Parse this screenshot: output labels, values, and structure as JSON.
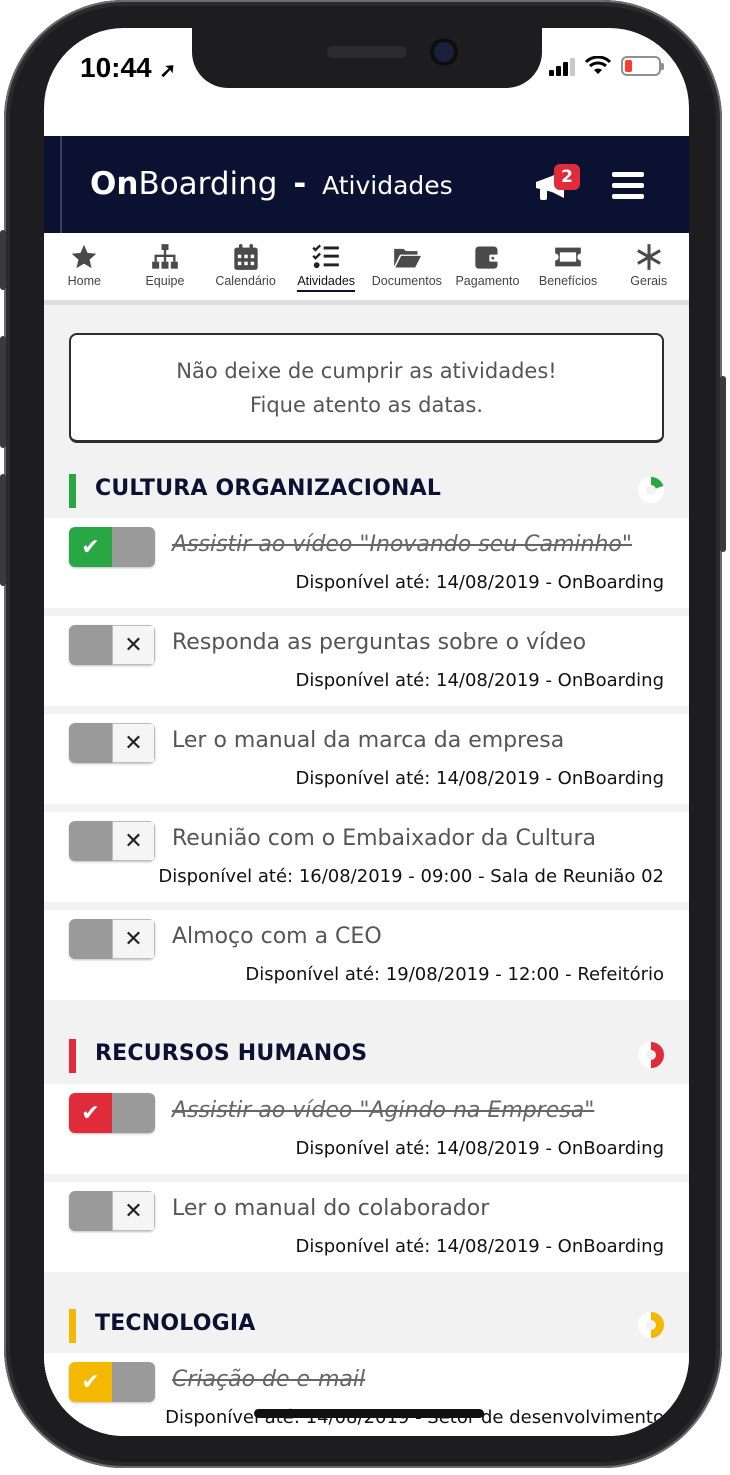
{
  "status": {
    "time": "10:44"
  },
  "header": {
    "brand_bold": "On",
    "brand_rest": "Boarding",
    "separator": "-",
    "section": "Atividades",
    "notification_count": "2"
  },
  "tabs": [
    {
      "label": "Home",
      "icon": "star-icon"
    },
    {
      "label": "Equipe",
      "icon": "org-chart-icon"
    },
    {
      "label": "Calendário",
      "icon": "calendar-icon"
    },
    {
      "label": "Atividades",
      "icon": "checklist-icon",
      "active": true
    },
    {
      "label": "Documentos",
      "icon": "folder-icon"
    },
    {
      "label": "Pagamento",
      "icon": "wallet-icon"
    },
    {
      "label": "Benefícios",
      "icon": "ticket-icon"
    },
    {
      "label": "Gerais",
      "icon": "asterisk-icon"
    }
  ],
  "notice": {
    "line1": "Não deixe de cumprir as atividades!",
    "line2": "Fique atento as datas."
  },
  "sections": [
    {
      "title": "CULTURA ORGANIZACIONAL",
      "color": "#2aa745",
      "progress": 0.2,
      "items": [
        {
          "title": "Assistir ao vídeo \"Inovando seu Caminho\"",
          "date": "Disponível até: 14/08/2019 - OnBoarding",
          "done": true
        },
        {
          "title": "Responda as perguntas sobre o vídeo",
          "date": "Disponível até: 14/08/2019 - OnBoarding",
          "done": false
        },
        {
          "title": "Ler o manual da marca da empresa",
          "date": "Disponível até: 14/08/2019 - OnBoarding",
          "done": false
        },
        {
          "title": "Reunião com o Embaixador da Cultura",
          "date": "Disponível até: 16/08/2019 - 09:00 - Sala de Reunião 02",
          "done": false
        },
        {
          "title": "Almoço com a CEO",
          "date": "Disponível até: 19/08/2019 - 12:00 - Refeitório",
          "done": false
        }
      ]
    },
    {
      "title": "RECURSOS HUMANOS",
      "color": "#e02b3b",
      "progress": 0.5,
      "items": [
        {
          "title": "Assistir ao vídeo \"Agindo na Empresa\"",
          "date": "Disponível até: 14/08/2019 - OnBoarding",
          "done": true
        },
        {
          "title": "Ler o manual do colaborador",
          "date": "Disponível até: 14/08/2019 - OnBoarding",
          "done": false
        }
      ]
    },
    {
      "title": "TECNOLOGIA",
      "color": "#f5b800",
      "progress": 0.5,
      "items": [
        {
          "title": "Criação de e-mail",
          "date": "Disponível até: 14/08/2019 - Setor de desenvolvimento",
          "done": true
        }
      ]
    }
  ]
}
